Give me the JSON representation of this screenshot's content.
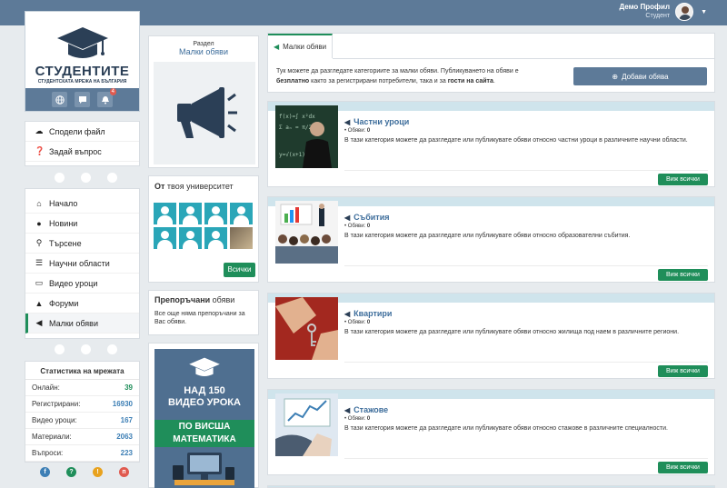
{
  "header": {
    "user_name": "Демо Профил",
    "user_role": "Студент"
  },
  "logo": {
    "title": "СТУДЕНТИТЕ",
    "subtitle": "СТУДЕНТСКАТА МРЕЖА НА БЪЛГАРИЯ",
    "notification_count": "4"
  },
  "quick_menu": [
    {
      "label": "Сподели файл",
      "icon": "cloud-upload-icon"
    },
    {
      "label": "Задай въпрос",
      "icon": "question-icon"
    }
  ],
  "main_menu": [
    {
      "label": "Начало",
      "icon": "home-icon"
    },
    {
      "label": "Новини",
      "icon": "info-icon"
    },
    {
      "label": "Търсене",
      "icon": "search-icon"
    },
    {
      "label": "Научни области",
      "icon": "list-icon"
    },
    {
      "label": "Видео уроци",
      "icon": "monitor-icon"
    },
    {
      "label": "Форуми",
      "icon": "graduation-cap-icon"
    },
    {
      "label": "Малки обяви",
      "icon": "megaphone-icon",
      "active": true
    }
  ],
  "stats": {
    "title": "Статистика на мрежата",
    "rows": [
      {
        "label": "Онлайн:",
        "value": "39",
        "color": "#1f8e5a"
      },
      {
        "label": "Регистрирани:",
        "value": "16930",
        "color": "#3d7fb5"
      },
      {
        "label": "Видео уроци:",
        "value": "167",
        "color": "#3d7fb5"
      },
      {
        "label": "Материали:",
        "value": "2063",
        "color": "#3d7fb5"
      },
      {
        "label": "Въпроси:",
        "value": "223",
        "color": "#3d7fb5"
      }
    ]
  },
  "social": [
    {
      "glyph": "f",
      "color": "#3d7fb5"
    },
    {
      "glyph": "?",
      "color": "#1f8e5a"
    },
    {
      "glyph": "!",
      "color": "#e8a21e"
    },
    {
      "glyph": "п",
      "color": "#e05a4f"
    }
  ],
  "section": {
    "label": "Раздел",
    "name": "Малки обяви"
  },
  "university": {
    "title_bold": "От",
    "title_rest": " твоя университет",
    "button": "Всички"
  },
  "recommended": {
    "title_bold": "Препоръчани",
    "title_rest": " обяви",
    "text": "Все още няма препоръчани за Вас обяви."
  },
  "ad": {
    "line1": "НАД 150",
    "line2": "ВИДЕО УРОКА",
    "line3": "ПО ВИСША",
    "line4": "МАТЕМАТИКА"
  },
  "main": {
    "tab": "Малки обяви",
    "intro_1": "Тук можете да разгледате категориите за малки обяви. Публикуването на обяви е ",
    "intro_bold1": "безплатно",
    "intro_2": " както за регистрирани потребители, така и за ",
    "intro_bold2": "гости на сайта",
    "intro_3": ".",
    "add_button": "Добави обява"
  },
  "categories": [
    {
      "title": "Частни уроци",
      "count_label": "Обяви:",
      "count": "0",
      "desc": "В тази категория можете да разгледате или публикувате обяви относно частни уроци в различните научни области.",
      "button": "Виж всички"
    },
    {
      "title": "Събития",
      "count_label": "Обяви:",
      "count": "0",
      "desc": "В тази категория можете да разгледате или публикувате обяви относно образователни събития.",
      "button": "Виж всички"
    },
    {
      "title": "Квартири",
      "count_label": "Обяви:",
      "count": "0",
      "desc": "В тази категория можете да разгледате или публикувате обяви относно жилища под наем в различните региони.",
      "button": "Виж всички"
    },
    {
      "title": "Стажове",
      "count_label": "Обяви:",
      "count": "0",
      "desc": "В тази категория можете да разгледате или публикувате обяви относно стажове в различните специалности.",
      "button": "Виж всички"
    }
  ]
}
